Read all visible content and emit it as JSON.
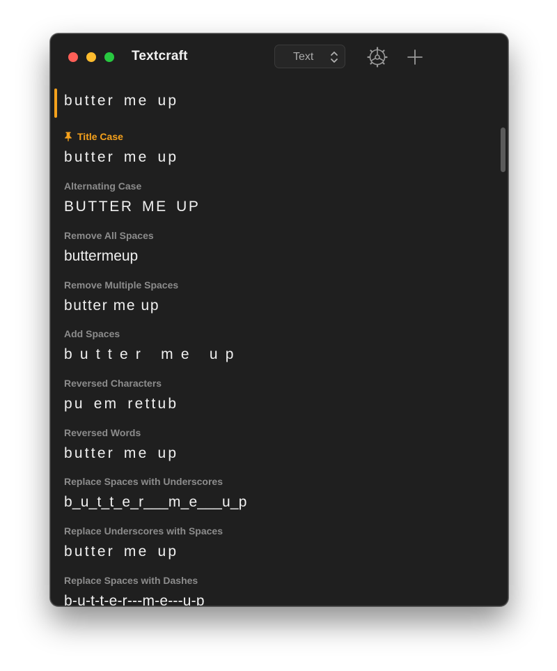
{
  "app": {
    "title": "Textcraft",
    "mode_select": "Text",
    "icons": {
      "settings": "gear-icon",
      "add": "plus-icon",
      "pin": "pin-icon",
      "mode_chevrons": "chevron-updown-icon"
    },
    "colors": {
      "accent": "#f5a11c",
      "window_bg": "#1f1f1f",
      "close": "#ff5f57",
      "minimize": "#febc2e",
      "zoom": "#28c840"
    }
  },
  "input": {
    "value": "butter me up"
  },
  "transformations": [
    {
      "title": "Title Case",
      "value": "butter me up",
      "pinned": true
    },
    {
      "title": "Alternating Case",
      "value": "BUTTER ME UP"
    },
    {
      "title": "Remove All Spaces",
      "value": "buttermeup"
    },
    {
      "title": "Remove Multiple Spaces",
      "value": "butter me up"
    },
    {
      "title": "Add Spaces",
      "value": "b u t t e r   m e   u p"
    },
    {
      "title": "Reversed Characters",
      "value": "pu em rettub"
    },
    {
      "title": "Reversed Words",
      "value": "butter me up"
    },
    {
      "title": "Replace Spaces with Underscores",
      "value": "b_u_t_t_e_r___m_e___u_p"
    },
    {
      "title": "Replace Underscores with Spaces",
      "value": "butter me up"
    },
    {
      "title": "Replace Spaces with Dashes",
      "value": "b-u-t-t-e-r---m-e---u-p"
    }
  ]
}
